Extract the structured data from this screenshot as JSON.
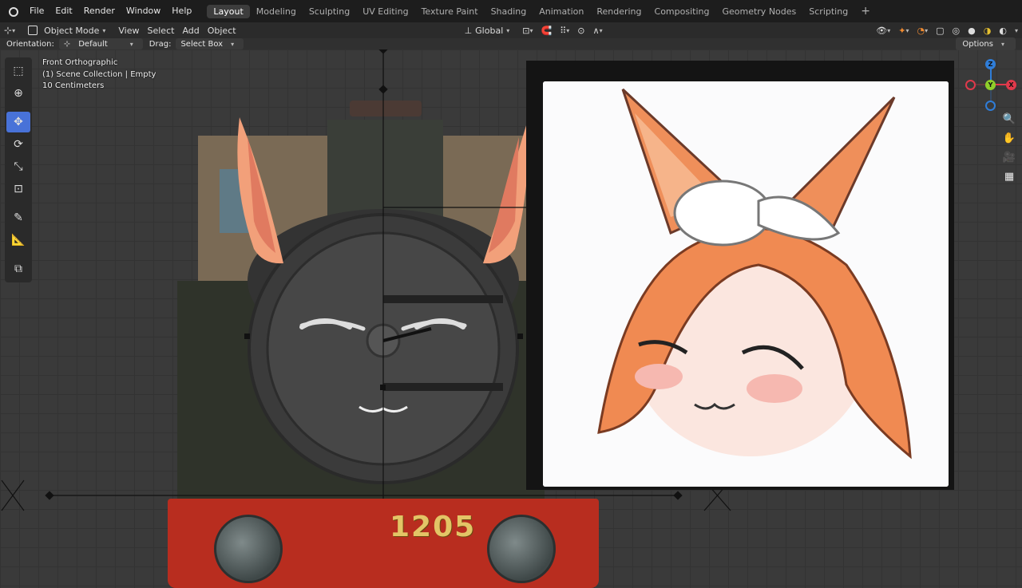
{
  "menubar": {
    "items": [
      "File",
      "Edit",
      "Render",
      "Window",
      "Help"
    ]
  },
  "workspaces": {
    "tabs": [
      "Layout",
      "Modeling",
      "Sculpting",
      "UV Editing",
      "Texture Paint",
      "Shading",
      "Animation",
      "Rendering",
      "Compositing",
      "Geometry Nodes",
      "Scripting"
    ],
    "active": "Layout",
    "add_label": "+"
  },
  "viewport_header": {
    "mode_label": "Object Mode",
    "menus": [
      "View",
      "Select",
      "Add",
      "Object"
    ],
    "transform_orientation": "Global"
  },
  "tool_header": {
    "orientation_label": "Orientation:",
    "orientation_value": "Default",
    "drag_label": "Drag:",
    "drag_value": "Select Box",
    "options_label": "Options"
  },
  "overlay_info": {
    "view_name": "Front Orthographic",
    "collection": "(1) Scene Collection | Empty",
    "scale": "10 Centimeters"
  },
  "gizmo": {
    "axes": [
      "Z",
      "Y",
      "X"
    ],
    "colors": {
      "x": "#e0394b",
      "y": "#8fcf2a",
      "z": "#2f7dd8"
    }
  },
  "scene": {
    "locomotive_number": "1205",
    "colors": {
      "buffer_beam": "#b82d1f",
      "boiler": "#454545",
      "ears": "#f2a07a",
      "hair": "#f08a52"
    }
  },
  "accent_color": "#4872d8"
}
